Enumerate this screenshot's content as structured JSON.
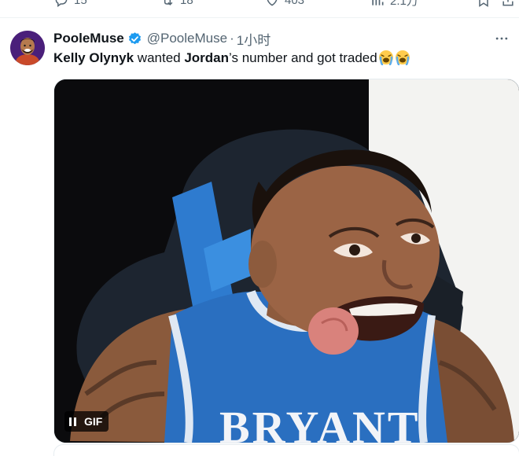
{
  "top_actions": [
    {
      "name": "reply",
      "icon": "reply-icon",
      "count": "15"
    },
    {
      "name": "retweet",
      "icon": "retweet-icon",
      "count": "18"
    },
    {
      "name": "like",
      "icon": "heart-icon",
      "count": "403"
    },
    {
      "name": "views",
      "icon": "views-icon",
      "count": "2.1万"
    }
  ],
  "tweet": {
    "display_name": "PooleMuse",
    "handle": "@PooleMuse",
    "separator": "·",
    "time": "1小时",
    "text": {
      "part1": "Kelly Olynyk",
      "part2": " wanted ",
      "part3": "Jordan",
      "part4": "’s number and got traded"
    },
    "emoji": [
      "loudly-crying-face",
      "loudly-crying-face"
    ],
    "media": {
      "type": "gif",
      "badge_label": "GIF",
      "jersey_text": "BRYANT"
    }
  },
  "colors": {
    "text": "#0f1419",
    "secondary": "#536471",
    "verified": "#1d9bf0",
    "jersey": "#2a6fc0"
  }
}
